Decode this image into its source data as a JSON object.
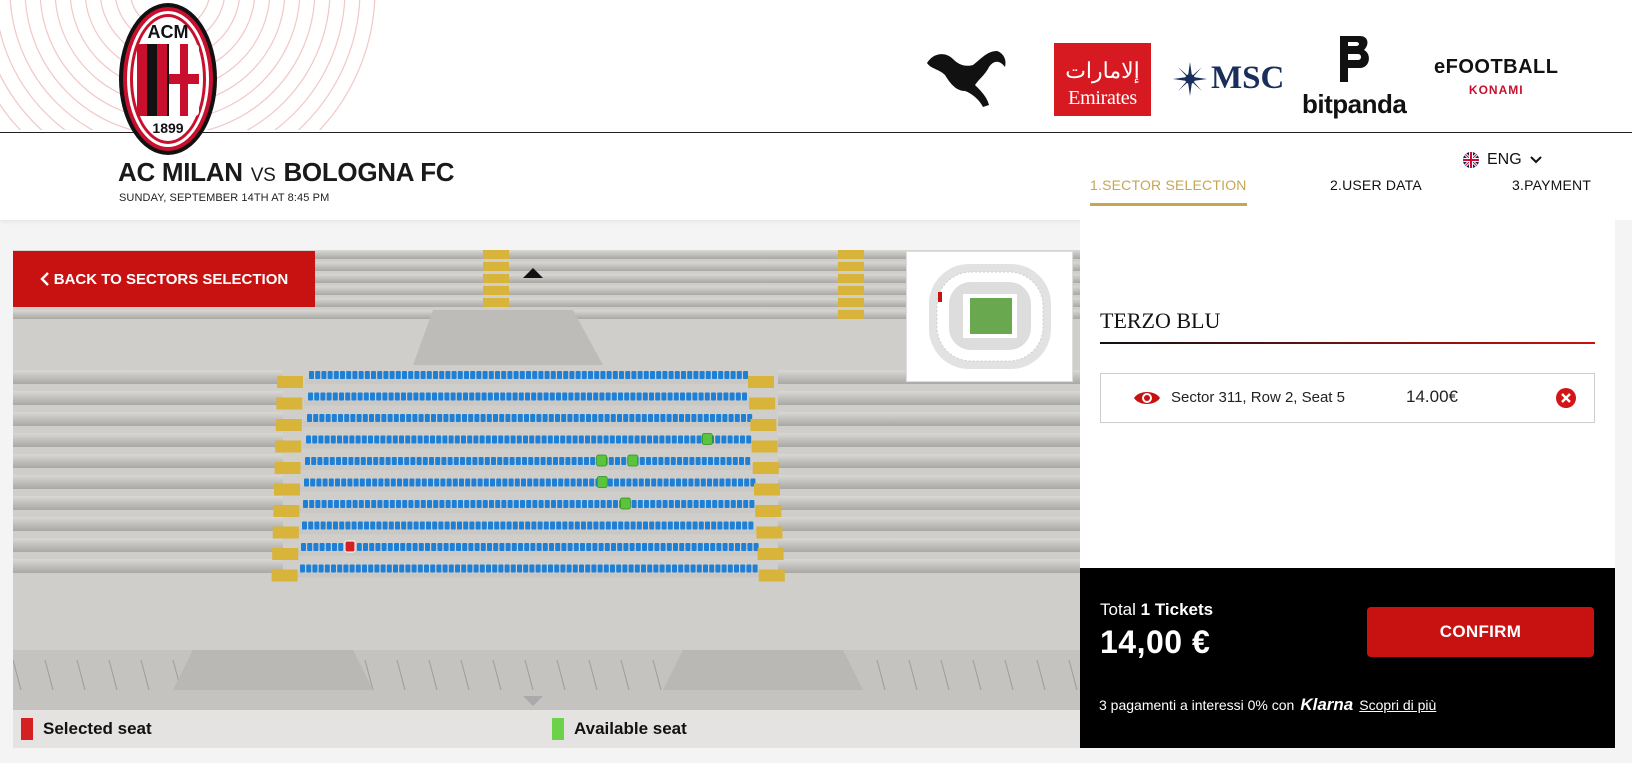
{
  "crest": {
    "top_text": "ACM",
    "year": "1899"
  },
  "sponsors": {
    "emirates": "Emirates",
    "msc": "MSC",
    "bitpanda": "bitpanda",
    "efootball": "eFOOTBALL",
    "konami": "KONAMI"
  },
  "match": {
    "home": "AC MILAN",
    "vs": "VS",
    "away": "BOLOGNA FC",
    "date": "SUNDAY, SEPTEMBER 14TH AT 8:45 PM"
  },
  "language": {
    "label": "ENG"
  },
  "steps": [
    {
      "label": "1.SECTOR SELECTION",
      "active": true
    },
    {
      "label": "2.USER DATA",
      "active": false
    },
    {
      "label": "3.PAYMENT",
      "active": false
    }
  ],
  "back_button": {
    "label": "BACK TO SECTORS SELECTION"
  },
  "seat_map": {
    "rows": 10,
    "selected_seat": {
      "sector": "311",
      "row": 2,
      "seat": 5
    },
    "colors": {
      "available": "#5ac43c",
      "selected": "#d42020",
      "occupied": "#1e7fd6",
      "stair": "#d8b43a"
    }
  },
  "legend": {
    "selected": "Selected seat",
    "available": "Available seat",
    "selected_color": "#d42020",
    "available_color": "#6cd24a"
  },
  "sector": {
    "name": "TERZO BLU"
  },
  "ticket": {
    "description": "Sector 311, Row 2, Seat 5",
    "price": "14.00€",
    "icons": [
      "eye-icon",
      "remove-icon"
    ]
  },
  "total": {
    "label": "Total",
    "count": "1 Tickets",
    "amount": "14,00 €",
    "confirm_label": "CONFIRM"
  },
  "klarna": {
    "text": "3 pagamenti a interessi 0% con",
    "brand": "Klarna",
    "link": "Scopri di più"
  },
  "accent_colors": {
    "red": "#c81212",
    "gold": "#c7a652",
    "black": "#000000"
  }
}
